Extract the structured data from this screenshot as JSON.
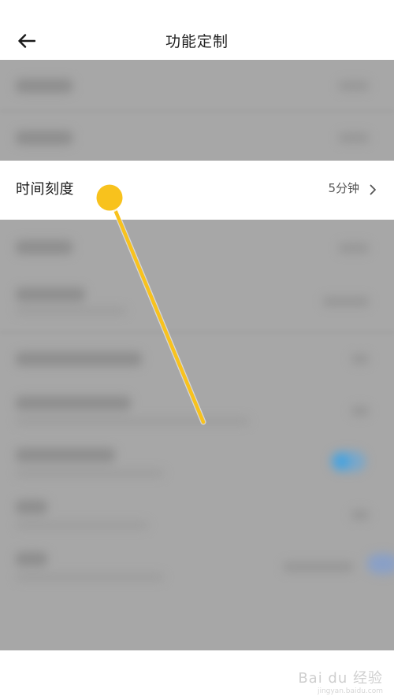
{
  "header": {
    "title": "功能定制",
    "back_icon": "arrow-left-icon"
  },
  "highlighted_item": {
    "label": "时间刻度",
    "value": "5分钟",
    "chevron_icon": "chevron-right-icon"
  },
  "annotation": {
    "color": "#F8C21D"
  },
  "watermark": {
    "brand": "Bai du 经验",
    "url": "jingyan.baidu.com"
  },
  "colors": {
    "overlay": "#A7A7A7",
    "background": "#FFFFFF",
    "toggle_on": "#4AA3DD"
  }
}
